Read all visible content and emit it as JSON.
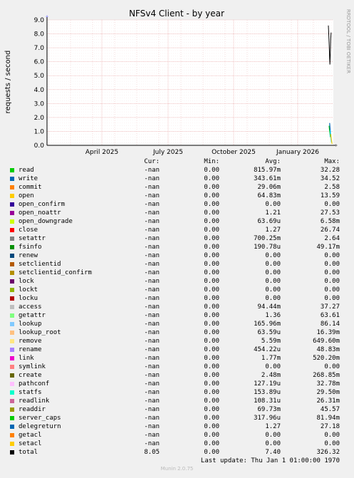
{
  "chart_data": {
    "type": "line",
    "title": "NFSv4 Client - by year",
    "ylabel": "requests / second",
    "ylim": [
      0,
      9
    ],
    "yticks": [
      "0.0",
      "1.0",
      "2.0",
      "3.0",
      "4.0",
      "5.0",
      "6.0",
      "7.0",
      "8.0",
      "9.0"
    ],
    "xticks": [
      "April 2025",
      "July 2025",
      "October 2025",
      "January 2026"
    ],
    "grid": true,
    "side_label": "RRDTOOL / TOBI OETIKER",
    "total_series": {
      "name": "total",
      "color": "#000000",
      "points": [
        8.6,
        8.0,
        7.3,
        6.5,
        5.8,
        6.6,
        7.6,
        8.1
      ]
    },
    "small_series": [
      {
        "color": "#00cc00",
        "points": [
          1.4,
          1.1,
          0.9,
          0.6
        ]
      },
      {
        "color": "#0066b3",
        "points": [
          1.6,
          1.2,
          0.8,
          0.5
        ]
      },
      {
        "color": "#00ccff",
        "points": [
          1.1,
          0.7,
          0.4,
          0.2
        ]
      },
      {
        "color": "#ffcc00",
        "points": [
          0.8,
          0.5,
          0.3,
          0.1
        ]
      }
    ],
    "legend_headers": {
      "cur": "Cur:",
      "min": "Min:",
      "avg": "Avg:",
      "max": "Max:"
    },
    "legend": [
      {
        "name": "read",
        "color": "#00cc00",
        "cur": "-nan",
        "min": "0.00",
        "avg": "815.97m",
        "max": "32.28"
      },
      {
        "name": "write",
        "color": "#0066b3",
        "cur": "-nan",
        "min": "0.00",
        "avg": "343.61m",
        "max": "34.52"
      },
      {
        "name": "commit",
        "color": "#ff8000",
        "cur": "-nan",
        "min": "0.00",
        "avg": "29.06m",
        "max": "2.58"
      },
      {
        "name": "open",
        "color": "#ffcc00",
        "cur": "-nan",
        "min": "0.00",
        "avg": "64.83m",
        "max": "13.59"
      },
      {
        "name": "open_confirm",
        "color": "#330099",
        "cur": "-nan",
        "min": "0.00",
        "avg": "0.00",
        "max": "0.00"
      },
      {
        "name": "open_noattr",
        "color": "#990099",
        "cur": "-nan",
        "min": "0.00",
        "avg": "1.21",
        "max": "27.53"
      },
      {
        "name": "open_downgrade",
        "color": "#ccff00",
        "cur": "-nan",
        "min": "0.00",
        "avg": "63.69u",
        "max": "6.58m"
      },
      {
        "name": "close",
        "color": "#ff0000",
        "cur": "-nan",
        "min": "0.00",
        "avg": "1.27",
        "max": "26.74"
      },
      {
        "name": "setattr",
        "color": "#808080",
        "cur": "-nan",
        "min": "0.00",
        "avg": "700.25m",
        "max": "2.64"
      },
      {
        "name": "fsinfo",
        "color": "#008f00",
        "cur": "-nan",
        "min": "0.00",
        "avg": "190.78u",
        "max": "49.17m"
      },
      {
        "name": "renew",
        "color": "#00487d",
        "cur": "-nan",
        "min": "0.00",
        "avg": "0.00",
        "max": "0.00"
      },
      {
        "name": "setclientid",
        "color": "#b35a00",
        "cur": "-nan",
        "min": "0.00",
        "avg": "0.00",
        "max": "0.00"
      },
      {
        "name": "setclientid_confirm",
        "color": "#b38f00",
        "cur": "-nan",
        "min": "0.00",
        "avg": "0.00",
        "max": "0.00"
      },
      {
        "name": "lock",
        "color": "#6b006b",
        "cur": "-nan",
        "min": "0.00",
        "avg": "0.00",
        "max": "0.00"
      },
      {
        "name": "lockt",
        "color": "#8fb300",
        "cur": "-nan",
        "min": "0.00",
        "avg": "0.00",
        "max": "0.00"
      },
      {
        "name": "locku",
        "color": "#b30000",
        "cur": "-nan",
        "min": "0.00",
        "avg": "0.00",
        "max": "0.00"
      },
      {
        "name": "access",
        "color": "#bebebe",
        "cur": "-nan",
        "min": "0.00",
        "avg": "94.44m",
        "max": "37.27"
      },
      {
        "name": "getattr",
        "color": "#80ff80",
        "cur": "-nan",
        "min": "0.00",
        "avg": "1.36",
        "max": "63.61"
      },
      {
        "name": "lookup",
        "color": "#80c9ff",
        "cur": "-nan",
        "min": "0.00",
        "avg": "165.96m",
        "max": "86.14"
      },
      {
        "name": "lookup_root",
        "color": "#ffc080",
        "cur": "-nan",
        "min": "0.00",
        "avg": "63.59u",
        "max": "16.39m"
      },
      {
        "name": "remove",
        "color": "#ffe680",
        "cur": "-nan",
        "min": "0.00",
        "avg": "5.59m",
        "max": "649.60m"
      },
      {
        "name": "rename",
        "color": "#aa80ff",
        "cur": "-nan",
        "min": "0.00",
        "avg": "454.22u",
        "max": "48.83m"
      },
      {
        "name": "link",
        "color": "#ee00cc",
        "cur": "-nan",
        "min": "0.00",
        "avg": "1.77m",
        "max": "520.20m"
      },
      {
        "name": "symlink",
        "color": "#ff8080",
        "cur": "-nan",
        "min": "0.00",
        "avg": "0.00",
        "max": "0.00"
      },
      {
        "name": "create",
        "color": "#666600",
        "cur": "-nan",
        "min": "0.00",
        "avg": "2.48m",
        "max": "268.85m"
      },
      {
        "name": "pathconf",
        "color": "#ffbfff",
        "cur": "-nan",
        "min": "0.00",
        "avg": "127.19u",
        "max": "32.78m"
      },
      {
        "name": "statfs",
        "color": "#00ffcc",
        "cur": "-nan",
        "min": "0.00",
        "avg": "153.89u",
        "max": "29.50m"
      },
      {
        "name": "readlink",
        "color": "#cc6699",
        "cur": "-nan",
        "min": "0.00",
        "avg": "108.31u",
        "max": "26.31m"
      },
      {
        "name": "readdir",
        "color": "#999900",
        "cur": "-nan",
        "min": "0.00",
        "avg": "69.73m",
        "max": "45.57"
      },
      {
        "name": "server_caps",
        "color": "#00cc00",
        "cur": "-nan",
        "min": "0.00",
        "avg": "317.96u",
        "max": "81.94m"
      },
      {
        "name": "delegreturn",
        "color": "#0066b3",
        "cur": "-nan",
        "min": "0.00",
        "avg": "1.27",
        "max": "27.18"
      },
      {
        "name": "getacl",
        "color": "#ff8000",
        "cur": "-nan",
        "min": "0.00",
        "avg": "0.00",
        "max": "0.00"
      },
      {
        "name": "setacl",
        "color": "#ffcc00",
        "cur": "-nan",
        "min": "0.00",
        "avg": "0.00",
        "max": "0.00"
      },
      {
        "name": "total",
        "color": "#000000",
        "cur": "8.05",
        "min": "0.00",
        "avg": "7.40",
        "max": "326.32"
      }
    ],
    "last_update": "Last update: Thu Jan  1 01:00:00 1970"
  },
  "footer": "Munin 2.0.75"
}
